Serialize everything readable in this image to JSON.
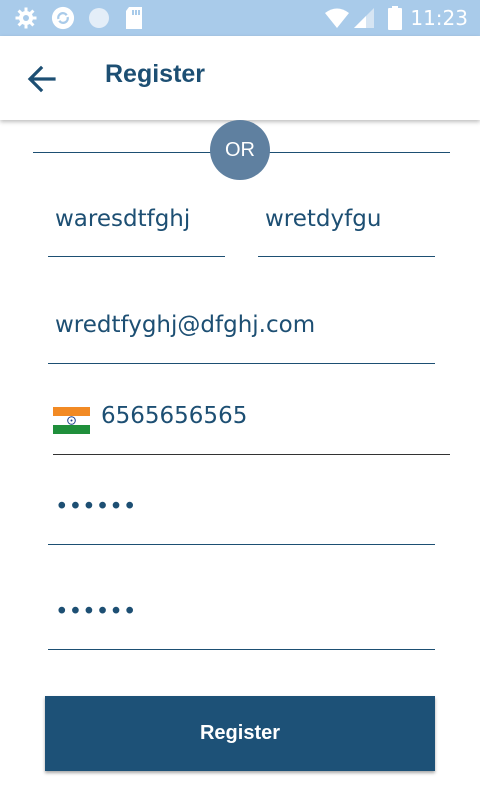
{
  "status_bar": {
    "time": "11:23",
    "icons": [
      "settings-icon",
      "sync-icon",
      "circle-icon",
      "sd-card-icon",
      "wifi-icon",
      "signal-icon",
      "battery-icon"
    ]
  },
  "app_bar": {
    "title": "Register",
    "back_icon": "arrow-back-icon"
  },
  "divider": {
    "label": "OR"
  },
  "form": {
    "first_name": "waresdtfghj",
    "last_name": "wretdyfgu",
    "email": "wredtfyghj@dfghj.com",
    "phone": {
      "country_flag": "india-flag-icon",
      "number": "6565656565"
    },
    "password": "••••••",
    "confirm_password": "••••••"
  },
  "register_button": {
    "label": "Register"
  },
  "colors": {
    "accent": "#1d4f73",
    "button": "#1d5177",
    "status_bar": "#a9cbea",
    "or_circle": "#5f80a0"
  }
}
